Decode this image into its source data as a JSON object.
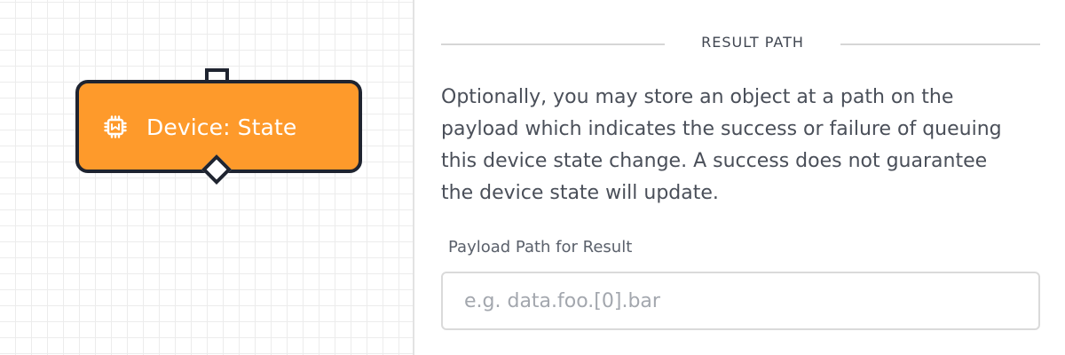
{
  "canvas": {
    "node": {
      "label": "Device: State",
      "icon": "chip-icon",
      "color": "#fe9a2b",
      "border_color": "#1f2430"
    }
  },
  "panel": {
    "section_title": "RESULT PATH",
    "description": "Optionally, you may store an object at a path on the payload which indicates the success or failure of queuing this device state change. A success does not guarantee the device state will update.",
    "field": {
      "label": "Payload Path for Result",
      "value": "",
      "placeholder": "e.g. data.foo.[0].bar"
    }
  }
}
